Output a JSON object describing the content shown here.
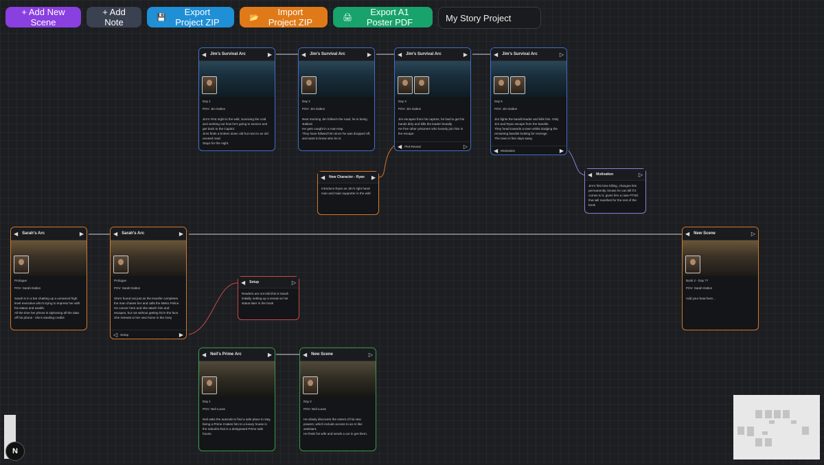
{
  "toolbar": {
    "add_scene": "+ Add New Scene",
    "add_note": "+ Add Note",
    "export_zip": "Export Project ZIP",
    "import_zip": "Import Project ZIP",
    "export_pdf": "Export A1 Poster PDF",
    "project_name": "My Story Project"
  },
  "colors": {
    "add_scene": "#8a3fe0",
    "add_note": "#3a4150",
    "export_zip": "#1f8fd6",
    "import_zip": "#e07a18",
    "export_pdf": "#17a36b"
  },
  "scenes": [
    {
      "arc": "Jim's Survival Arc",
      "day": "Day 1",
      "pov": "POV: Jim Dalton",
      "text": "Jim's First night in the wild, Surviving the cold and working out how he's going to survive and get back to the Capitol.\nJims finds a broken down old hut next to an old unused road.\nStays for the night.",
      "footer": ""
    },
    {
      "arc": "Jim's Survival Arc",
      "day": "Day 2",
      "pov": "POV: Jim Dalton",
      "text": "Next morning Jim follow's the road, he is being stalked.\nHe gets caught in a man-trap.\nThey have follwed him since he was dropped off, and want to know who he is",
      "footer": ""
    },
    {
      "arc": "Jim's Survival Arc",
      "day": "Day 3",
      "pov": "POV: Jim Dalton",
      "text": "Jim escapes from his captors, he had to get his hands dirty and kills the leader brutally.\nHe free other prisoners who loosely join him in the escape.",
      "footer": "Plot Reveal"
    },
    {
      "arc": "Jim's Survival Arc",
      "day": "Day 5",
      "pov": "POV: Jim Dalton",
      "text": "Jim fights the bandit leader and kills him. Only Jim and Ryan escape from the bandits.\nThey head towards a town whilst dodging the remaining bandits looking for revenge.\nThe town is five days away.",
      "footer": "Motivation"
    },
    {
      "arc": "Sarah's Arc",
      "day": "Prologue",
      "pov": "POV: Sarah Dalton",
      "text": "Sarah is in a bar chatting up a unnamed high level executive who's trying to impress her with his status and wealth.\nAll the time her phone is siphoning all the data off his phone - she's stealing credits",
      "footer": ""
    },
    {
      "arc": "Sarah's Arc",
      "day": "Prologue",
      "pov": "POV: Sarah Dalton",
      "text": "She's found out just as the transfer completes the man chases her and calls the Metro Police. He concer here and she attach him and escapes, but not without getting hit in the face.\nShe retreats to her new home in the Grey",
      "footer": "Setup"
    },
    {
      "arc": "New Scene",
      "day": "Book 2 - Day ??",
      "pov": "POV: Sarah Dalton",
      "text": "Add your beat here...",
      "footer": ""
    },
    {
      "arc": "Neil's Prime Arc",
      "day": "Day 1",
      "pov": "POV: Neil Lucas",
      "text": "Neil asks the autocab to find a safe place to stay, being a Prime it takes him to a luxury house in the suburbs that is a designated Prime safe house.",
      "footer": ""
    },
    {
      "arc": "New Scene",
      "day": "Day 2",
      "pov": "POV: Neil Lucas",
      "text": "He slowly discovers the extent of his new powers, which include access to an AI like assistant.\nHe finds his wife and sends a car to get them.",
      "footer": ""
    }
  ],
  "notes": [
    {
      "title": "New Character - Ryan",
      "text": "Introduce Ryan as Jim's right hand man and main supporter in the wild"
    },
    {
      "title": "Motivation",
      "text": "Jim's first time killing, changes him permanently, knows he can kill if it comes to it, gives him a case PTSD that will manifest for the rest of the book"
    },
    {
      "title": "Setup",
      "text": "Readers are not told this is Sarah initially, setting up a reveal on her status later in the book"
    }
  ],
  "logo": "N"
}
